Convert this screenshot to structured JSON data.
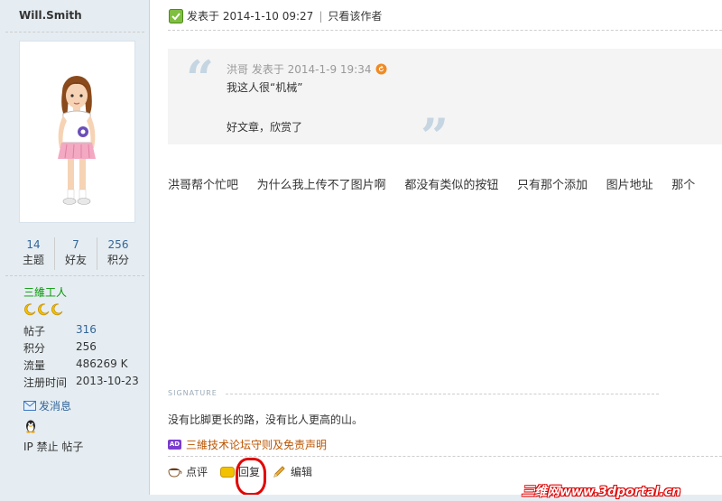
{
  "sidebar": {
    "username": "Will.Smith",
    "stats": [
      {
        "num": "14",
        "label": "主题"
      },
      {
        "num": "7",
        "label": "好友"
      },
      {
        "num": "256",
        "label": "积分"
      }
    ],
    "group": "三維工人",
    "info": [
      {
        "key": "帖子",
        "value": "316"
      },
      {
        "key": "积分",
        "value": "256"
      },
      {
        "key": "流量",
        "value": "486269 K"
      },
      {
        "key": "注册时间",
        "value": "2013-10-23"
      }
    ],
    "pm_label": "发消息",
    "ip_ban": "IP 禁止 帖子"
  },
  "post": {
    "posted_at": "发表于 2014-1-10 09:27",
    "only_author": "只看该作者",
    "quote": {
      "author_line": "洪哥 发表于 2014-1-9 19:34",
      "line1": "我这人很“机械”",
      "line2": "好文章，欣赏了"
    },
    "message": "洪哥帮个忙吧     为什么我上传不了图片啊     都没有类似的按钮     只有那个添加     图片地址     那个",
    "signature_label": "SIGNATURE",
    "signature_text": "没有比脚更长的路，没有比人更高的山。",
    "ad_badge": "AD",
    "rules_link": "三維技术论坛守则及免责声明",
    "actions": {
      "comment": "点评",
      "reply": "回复",
      "edit": "编辑"
    }
  },
  "watermark": "三维网www.3dportal.cn",
  "colors": {
    "sidebar_bg": "#e5edf2",
    "link": "#336699",
    "group": "#009900",
    "rules": "#bb5500",
    "annotation": "#e30000"
  }
}
